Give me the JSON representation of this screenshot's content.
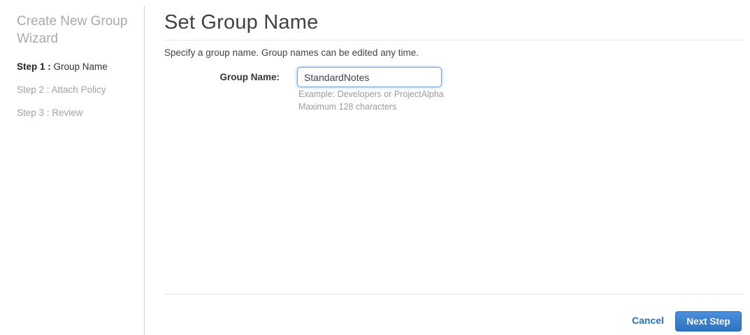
{
  "sidebar": {
    "title": "Create New Group Wizard",
    "steps": [
      {
        "prefix": "Step 1 :",
        "label": "Group Name"
      },
      {
        "prefix": "Step 2 :",
        "label": "Attach Policy"
      },
      {
        "prefix": "Step 3 :",
        "label": "Review"
      }
    ]
  },
  "main": {
    "title": "Set Group Name",
    "subtitle": "Specify a group name. Group names can be edited any time.",
    "form": {
      "label": "Group Name:",
      "value": "StandardNotes",
      "hint_example": "Example: Developers or ProjectAlpha",
      "hint_max": "Maximum 128 characters"
    },
    "footer": {
      "cancel_label": "Cancel",
      "next_label": "Next Step"
    }
  },
  "colors": {
    "link_blue": "#2a72b8",
    "button_gradient_top": "#4a90dd",
    "button_gradient_bottom": "#2e73c1",
    "input_focus_border": "#6aa6e0",
    "muted_text": "#a2a2a2"
  }
}
